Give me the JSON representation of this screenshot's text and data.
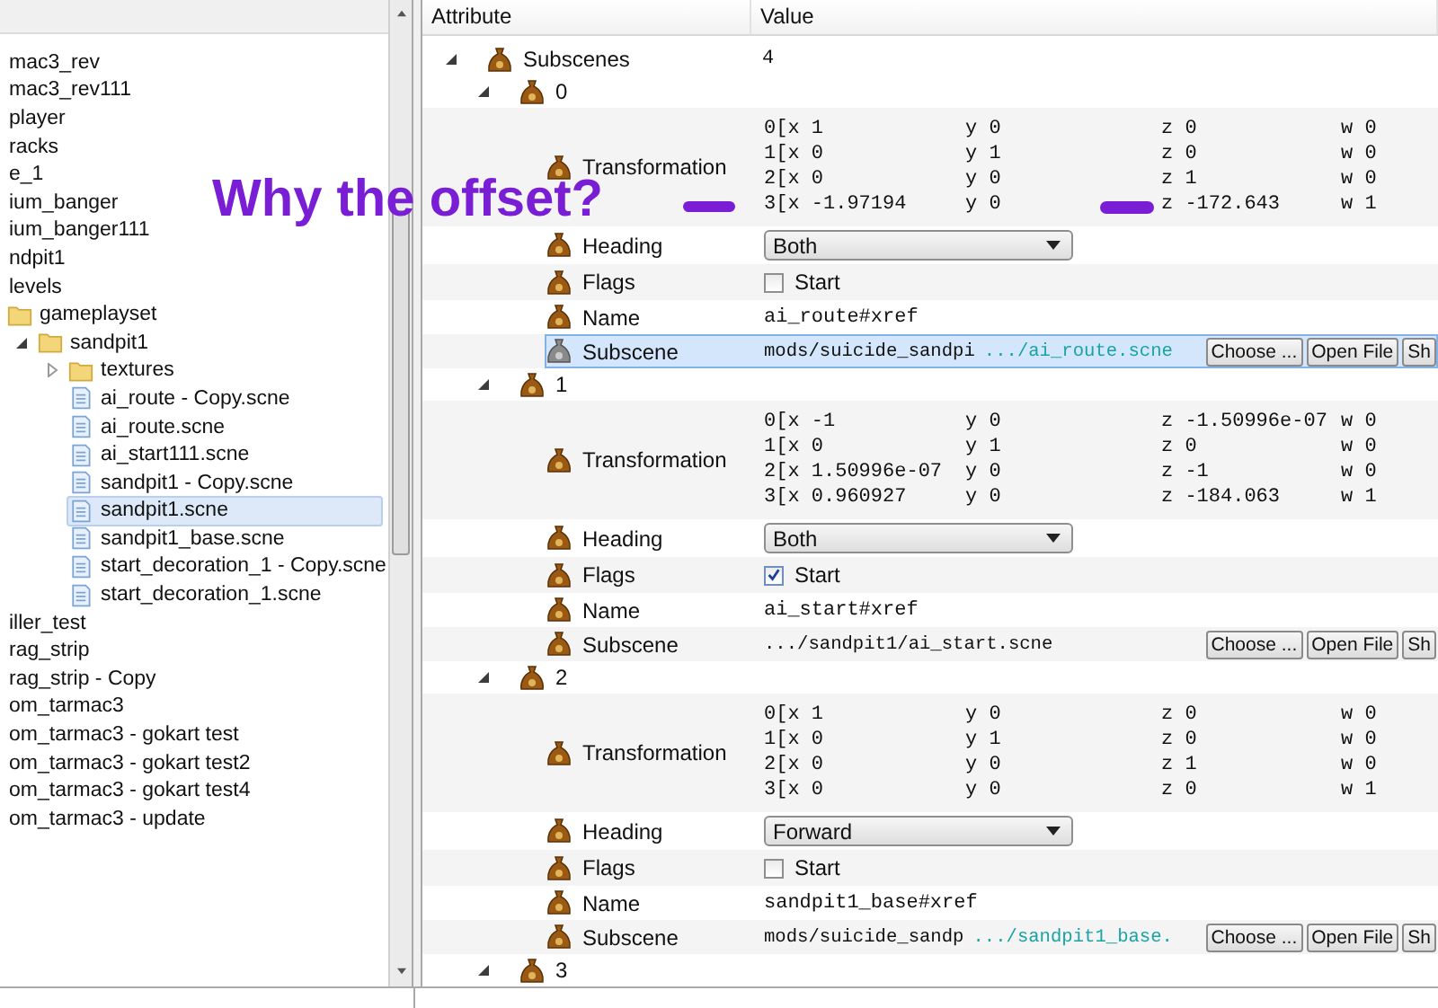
{
  "left_panel": {
    "tree": [
      {
        "label": "mac3_rev",
        "selected": false
      },
      {
        "label": "mac3_rev111",
        "selected": false
      },
      {
        "label": "player",
        "selected": false
      },
      {
        "label": "racks",
        "selected": false
      },
      {
        "label": "e_1",
        "selected": false
      },
      {
        "label": "ium_banger",
        "selected": false
      },
      {
        "label": "ium_banger111",
        "selected": false
      },
      {
        "label": "ndpit1",
        "selected": false
      },
      {
        "label": "levels",
        "selected": false,
        "children": [
          {
            "label": "gameplayset",
            "kind": "folder",
            "selected": false,
            "children": [
              {
                "label": "sandpit1",
                "kind": "folder",
                "expanded": true,
                "selected": false,
                "children": [
                  {
                    "label": "textures",
                    "kind": "folder",
                    "expanded": false,
                    "selected": false
                  },
                  {
                    "label": "ai_route - Copy.scne",
                    "kind": "file",
                    "selected": false
                  },
                  {
                    "label": "ai_route.scne",
                    "kind": "file",
                    "selected": false
                  },
                  {
                    "label": "ai_start111.scne",
                    "kind": "file",
                    "selected": false
                  },
                  {
                    "label": "sandpit1 - Copy.scne",
                    "kind": "file",
                    "selected": false
                  },
                  {
                    "label": "sandpit1.scne",
                    "kind": "file",
                    "selected": true
                  },
                  {
                    "label": "sandpit1_base.scne",
                    "kind": "file",
                    "selected": false
                  },
                  {
                    "label": "start_decoration_1 - Copy.scne",
                    "kind": "file",
                    "selected": false
                  },
                  {
                    "label": "start_decoration_1.scne",
                    "kind": "file",
                    "selected": false
                  }
                ]
              }
            ]
          }
        ]
      },
      {
        "label": "iller_test",
        "selected": false
      },
      {
        "label": "rag_strip",
        "selected": false
      },
      {
        "label": "rag_strip - Copy",
        "selected": false
      },
      {
        "label": "om_tarmac3",
        "selected": false
      },
      {
        "label": "om_tarmac3 - gokart test",
        "selected": false
      },
      {
        "label": "om_tarmac3 - gokart test2",
        "selected": false
      },
      {
        "label": "om_tarmac3 - gokart test4",
        "selected": false
      },
      {
        "label": "om_tarmac3 - update",
        "selected": false
      }
    ]
  },
  "annotation": {
    "text": "Why the offset?"
  },
  "properties": {
    "columns": [
      "Attribute",
      "Value"
    ],
    "root": {
      "label": "Subscenes",
      "value": "4",
      "expanded": true,
      "children": [
        {
          "index": "0",
          "expanded": true,
          "properties": [
            {
              "kind": "matrix",
              "label": "Transformation",
              "selected": false,
              "rows": [
                [
                  "0[x 1",
                  "y 0",
                  "z 0",
                  "w 0"
                ],
                [
                  "1[x 0",
                  "y 1",
                  "z 0",
                  "w 0"
                ],
                [
                  "2[x 0",
                  "y 0",
                  "z 1",
                  "w 0"
                ],
                [
                  "3[x -1.97194",
                  "y 0",
                  "z -172.643",
                  "w 1"
                ]
              ]
            },
            {
              "kind": "dropdown",
              "label": "Heading",
              "value": "Both",
              "selected": false
            },
            {
              "kind": "checkbox",
              "label": "Flags",
              "option": "Start",
              "checked": false,
              "selected": false
            },
            {
              "kind": "text",
              "label": "Name",
              "value": "ai_route#xref",
              "selected": false
            },
            {
              "kind": "file",
              "label": "Subscene",
              "value": "mods/suicide_sandpi",
              "link": ".../ai_route.scne",
              "buttons": [
                "Choose ...",
                "Open File",
                "Sh"
              ],
              "selected": true
            }
          ]
        },
        {
          "index": "1",
          "expanded": true,
          "properties": [
            {
              "kind": "matrix",
              "label": "Transformation",
              "selected": false,
              "rows": [
                [
                  "0[x -1",
                  "y 0",
                  "z -1.50996e-07",
                  "w 0"
                ],
                [
                  "1[x 0",
                  "y 1",
                  "z 0",
                  "w 0"
                ],
                [
                  "2[x 1.50996e-07",
                  "y 0",
                  "z -1",
                  "w 0"
                ],
                [
                  "3[x 0.960927",
                  "y 0",
                  "z -184.063",
                  "w 1"
                ]
              ]
            },
            {
              "kind": "dropdown",
              "label": "Heading",
              "value": "Both",
              "selected": false
            },
            {
              "kind": "checkbox",
              "label": "Flags",
              "option": "Start",
              "checked": true,
              "selected": false
            },
            {
              "kind": "text",
              "label": "Name",
              "value": "ai_start#xref",
              "selected": false
            },
            {
              "kind": "file",
              "label": "Subscene",
              "value": ".../sandpit1/ai_start.scne",
              "buttons": [
                "Choose ...",
                "Open File",
                "Sh"
              ],
              "selected": false
            }
          ]
        },
        {
          "index": "2",
          "expanded": true,
          "properties": [
            {
              "kind": "matrix",
              "label": "Transformation",
              "selected": false,
              "rows": [
                [
                  "0[x 1",
                  "y 0",
                  "z 0",
                  "w 0"
                ],
                [
                  "1[x 0",
                  "y 1",
                  "z 0",
                  "w 0"
                ],
                [
                  "2[x 0",
                  "y 0",
                  "z 1",
                  "w 0"
                ],
                [
                  "3[x 0",
                  "y 0",
                  "z 0",
                  "w 1"
                ]
              ]
            },
            {
              "kind": "dropdown",
              "label": "Heading",
              "value": "Forward",
              "selected": false
            },
            {
              "kind": "checkbox",
              "label": "Flags",
              "option": "Start",
              "checked": false,
              "selected": false
            },
            {
              "kind": "text",
              "label": "Name",
              "value": "sandpit1_base#xref",
              "selected": false
            },
            {
              "kind": "file",
              "label": "Subscene",
              "value": "mods/suicide_sandp",
              "link": ".../sandpit1_base.",
              "buttons": [
                "Choose ...",
                "Open File",
                "Sh"
              ],
              "selected": false
            }
          ]
        },
        {
          "index": "3",
          "expanded": true
        }
      ]
    }
  }
}
